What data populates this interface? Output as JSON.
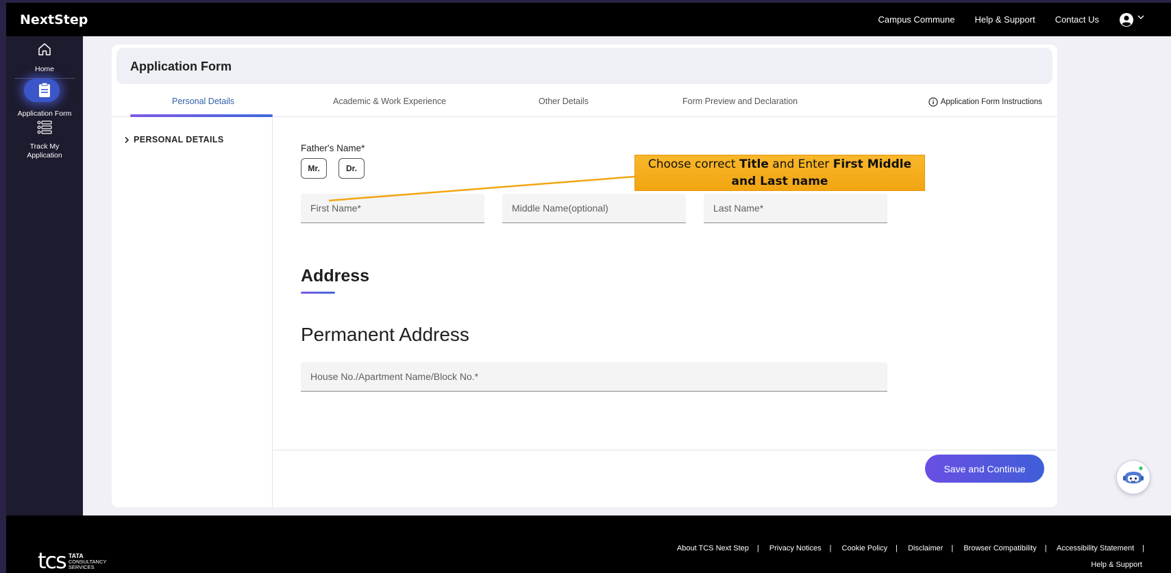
{
  "header": {
    "brand": "NextStep",
    "nav": [
      "Campus Commune",
      "Help & Support",
      "Contact Us"
    ]
  },
  "sidebar": {
    "items": [
      {
        "label": "Home",
        "icon": "home-icon"
      },
      {
        "label": "Application Form",
        "icon": "clipboard-icon"
      },
      {
        "label": "Track My Application",
        "icon": "list-icon"
      }
    ]
  },
  "page": {
    "title": "Application Form",
    "tabs": [
      "Personal Details",
      "Academic & Work Experience",
      "Other Details",
      "Form Preview and Declaration"
    ],
    "instructions": "Application Form Instructions",
    "section_nav": "PERSONAL DETAILS"
  },
  "form": {
    "fathers_name_label": "Father's Name*",
    "titles": [
      "Mr.",
      "Dr."
    ],
    "first_name_placeholder": "First Name*",
    "middle_name_placeholder": "Middle Name(optional)",
    "last_name_placeholder": "Last Name*",
    "address_heading": "Address",
    "permanent_address_heading": "Permanent Address",
    "house_placeholder": "House No./Apartment Name/Block No.*",
    "save_button": "Save and Continue"
  },
  "callout": {
    "part1": "Choose correct ",
    "bold1": "Title",
    "part2": " and Enter ",
    "bold2": "First Middle and Last name"
  },
  "footer": {
    "logo_mark": "tcs",
    "logo_line1": "TATA",
    "logo_line2": "CONSULTANCY",
    "logo_line3": "SERVICES",
    "links": [
      "About TCS Next Step",
      "Privacy Notices",
      "Cookie Policy",
      "Disclaimer",
      "Browser Compatibility",
      "Accessibility Statement"
    ],
    "link_last": "Help & Support"
  },
  "colors": {
    "accent": "#3f5ed8",
    "callout": "#f5ad1c",
    "active_tab": "#2f5fa6"
  }
}
